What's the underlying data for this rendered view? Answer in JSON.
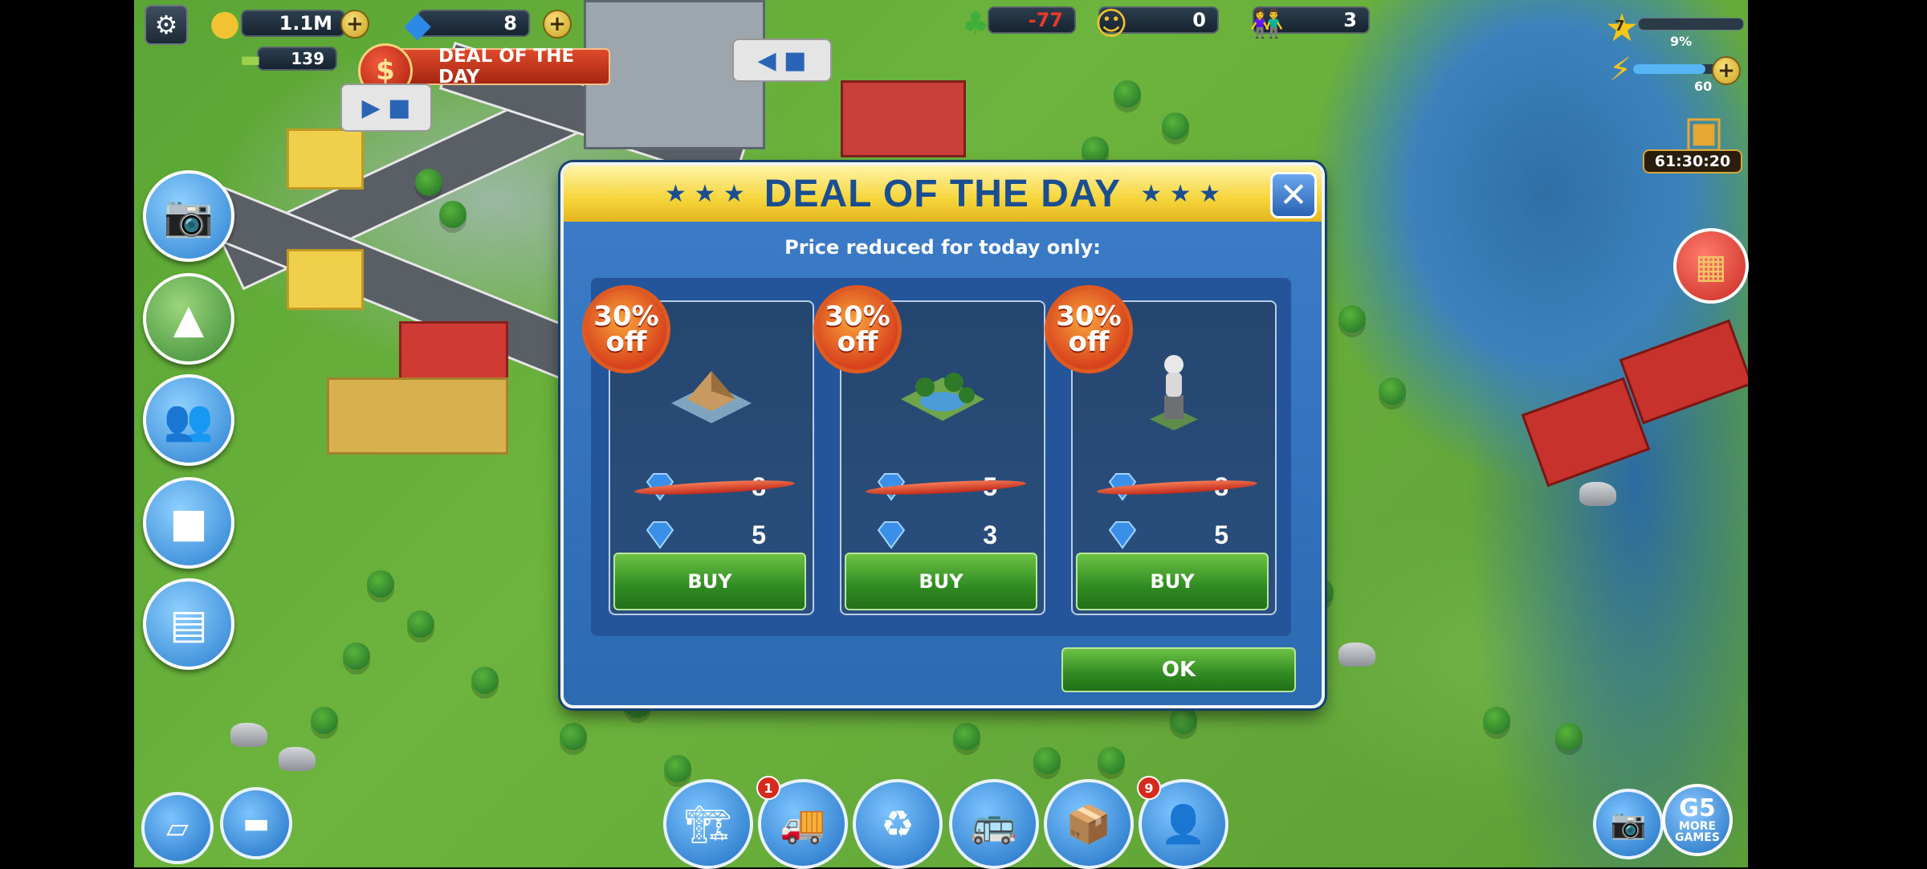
{
  "hud": {
    "coins": "1.1M",
    "gems": "8",
    "secondary_currency": "139",
    "ecology": "-77",
    "happiness": "0",
    "population": "3",
    "level": "7",
    "level_progress": "9%",
    "energy": "60",
    "timer": "61:30:20",
    "deal_banner": "DEAL OF THE DAY",
    "bottom_badges": {
      "delivery": "1",
      "g5_friends": "9"
    },
    "g5_label": "MORE\nGAMES"
  },
  "modal": {
    "title": "DEAL OF THE DAY",
    "subtitle": "Price reduced for today only:",
    "discount_label": "30%",
    "discount_suffix": "off",
    "items": [
      {
        "name": "workshop-building",
        "old_price": "8",
        "new_price": "5",
        "buy_label": "BUY"
      },
      {
        "name": "pond-park",
        "old_price": "5",
        "new_price": "3",
        "buy_label": "BUY"
      },
      {
        "name": "astronaut-statue",
        "old_price": "8",
        "new_price": "5",
        "buy_label": "BUY"
      }
    ],
    "ok_label": "OK"
  },
  "colors": {
    "modal_blue": "#2c6ab2",
    "header_yellow": "#f6d53a",
    "title_blue": "#1b4d91",
    "buy_green": "#2f8b22",
    "seal_orange": "#e05a20"
  }
}
